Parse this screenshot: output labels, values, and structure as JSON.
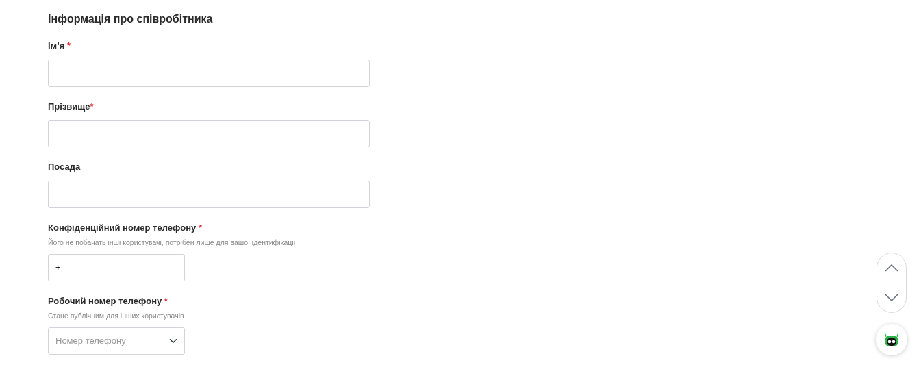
{
  "section_title": "Інформація про співробітника",
  "fields": [
    {
      "kind": "text",
      "label": "Ім’я",
      "required_mark": "*",
      "mark_gap": true,
      "wide": true
    },
    {
      "kind": "text",
      "label": "Прізвище",
      "required_mark": "*",
      "mark_gap": false,
      "wide": true
    },
    {
      "kind": "text",
      "label": "Посада",
      "wide": true
    },
    {
      "kind": "text",
      "label": "Конфіденційний номер телефону",
      "required_mark": "*",
      "mark_gap": true,
      "hint": "Його не побачать інші користувачі, потрібен лише для вашої ідентифікації",
      "value": "+",
      "wide": false
    },
    {
      "kind": "select",
      "label": "Робочий номер телефону",
      "required_mark": "*",
      "mark_gap": true,
      "hint": "Стане публічним для інших користувачів",
      "placeholder": "Номер телефону",
      "wide": false
    }
  ]
}
